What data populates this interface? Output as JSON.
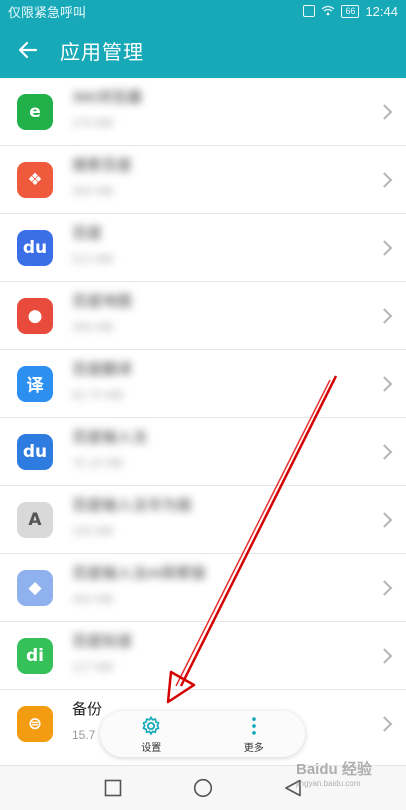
{
  "status_bar": {
    "left_text": "仅限紧急呼叫",
    "battery": "66",
    "time": "12:44"
  },
  "app_bar": {
    "title": "应用管理"
  },
  "apps": [
    {
      "name": "360浏览器",
      "size": "276 MB",
      "icon": "globe-e-icon",
      "icon_color": "#22b04a",
      "glyph": "e",
      "blurred": true
    },
    {
      "name": "搜索百度",
      "size": "300 MB",
      "icon": "game-icon",
      "icon_color": "#f05a3c",
      "glyph": "❖",
      "blurred": true
    },
    {
      "name": "百度",
      "size": "512 MB",
      "icon": "baidu-paw-icon",
      "icon_color": "#3a6fe8",
      "glyph": "du",
      "blurred": true
    },
    {
      "name": "百度地图",
      "size": "356 MB",
      "icon": "map-pin-icon",
      "icon_color": "#e84b3c",
      "glyph": "●",
      "blurred": true
    },
    {
      "name": "百度翻译",
      "size": "62.70 MB",
      "icon": "translate-icon",
      "icon_color": "#2d8ff0",
      "glyph": "译",
      "blurred": true
    },
    {
      "name": "百度输入法",
      "size": "75.15 MB",
      "icon": "keyboard-du-icon",
      "icon_color": "#2f7ce0",
      "glyph": "du",
      "blurred": true
    },
    {
      "name": "百度输入法华为版",
      "size": "156 MB",
      "icon": "a-letter-icon",
      "icon_color": "#d9d9d9",
      "glyph": "A",
      "blurred": true
    },
    {
      "name": "百度输入法AI探索版",
      "size": "400 MB",
      "icon": "bot-icon",
      "icon_color": "#8fb2ee",
      "glyph": "◆",
      "blurred": true
    },
    {
      "name": "百度知道",
      "size": "127 MB",
      "icon": "zhidao-icon",
      "icon_color": "#36c05a",
      "glyph": "di",
      "blurred": true
    },
    {
      "name": "备份",
      "size": "15.7",
      "icon": "backup-icon",
      "icon_color": "#f39c12",
      "glyph": "⊜",
      "blurred": false
    }
  ],
  "popup": {
    "settings_label": "设置",
    "more_label": "更多"
  },
  "watermark": {
    "text": "Baidu 经验",
    "sub": "jingyan.baidu.com"
  },
  "colors": {
    "accent": "#17a9b8",
    "arrow": "#d40000"
  }
}
